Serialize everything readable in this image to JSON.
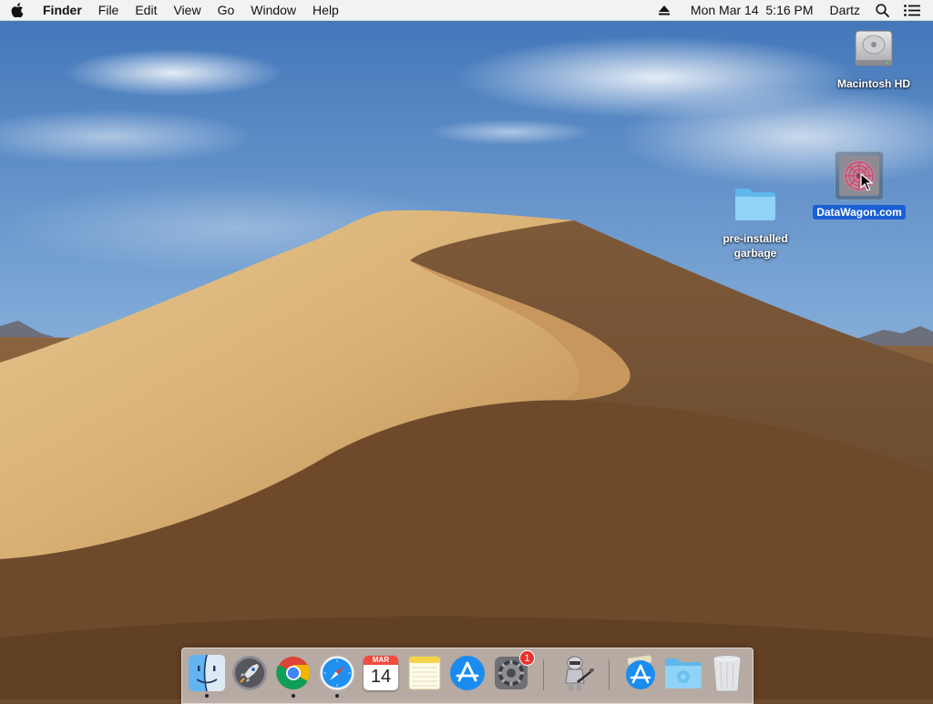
{
  "menubar": {
    "app_name": "Finder",
    "menus": [
      "File",
      "Edit",
      "View",
      "Go",
      "Window",
      "Help"
    ],
    "status": {
      "datetime": "Mon Mar 14  5:16 PM",
      "user": "Dartz"
    }
  },
  "desktop": {
    "icons": [
      {
        "label": "Macintosh HD",
        "icon": "hard-drive-icon"
      },
      {
        "label": "DataWagon.com",
        "icon": "datawagon-icon",
        "selected": true
      },
      {
        "label": "pre-installed\ngarbage",
        "icon": "folder-icon"
      }
    ]
  },
  "dock": {
    "apps": [
      {
        "name": "Finder",
        "icon": "finder-icon",
        "running": true
      },
      {
        "name": "Launchpad",
        "icon": "launchpad-icon",
        "running": false
      },
      {
        "name": "Google Chrome",
        "icon": "chrome-icon",
        "running": true
      },
      {
        "name": "Safari",
        "icon": "safari-icon",
        "running": true
      },
      {
        "name": "Calendar",
        "icon": "calendar-icon",
        "running": false,
        "month": "MAR",
        "day": "14"
      },
      {
        "name": "Notes",
        "icon": "notes-icon",
        "running": false
      },
      {
        "name": "App Store",
        "icon": "app-store-icon",
        "running": false
      },
      {
        "name": "System Preferences",
        "icon": "system-preferences-icon",
        "running": false,
        "badge": "1"
      },
      {
        "name": "Automator",
        "icon": "automator-icon",
        "running": false
      },
      {
        "name": "Applications",
        "icon": "applications-stack-icon",
        "running": false
      },
      {
        "name": "Downloads",
        "icon": "downloads-folder-icon",
        "running": false
      },
      {
        "name": "Trash",
        "icon": "trash-icon",
        "running": false
      }
    ]
  },
  "colors": {
    "sky": "#5f8fc8",
    "dune_light": "#e2bf86",
    "dune_dark": "#6b4a2e",
    "selection": "#1a5fd3",
    "badge": "#e8312a"
  }
}
